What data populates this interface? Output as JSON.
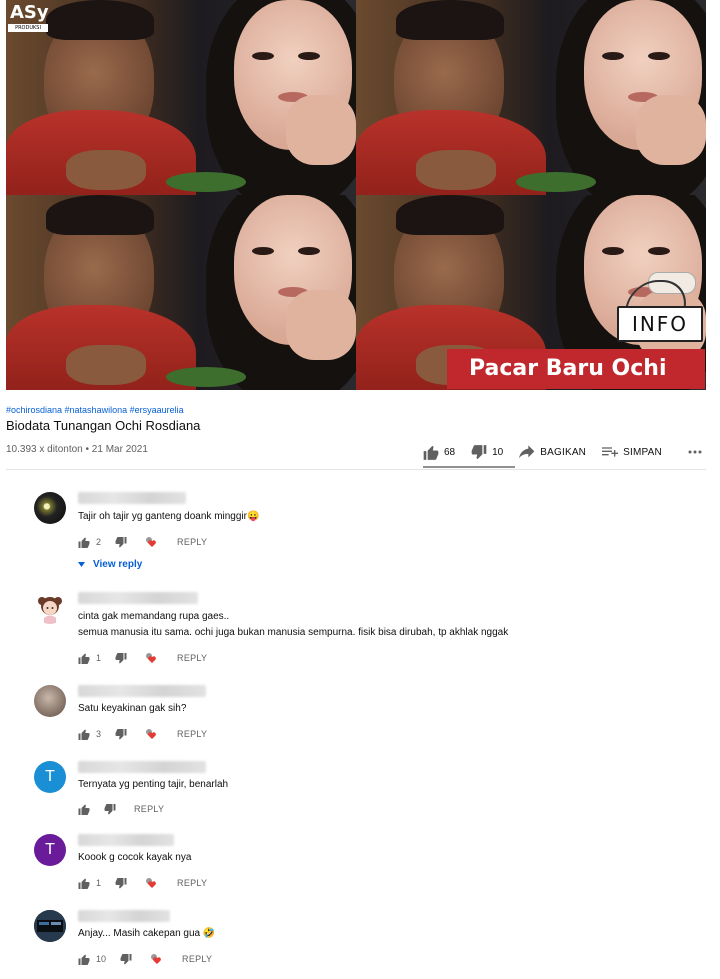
{
  "video": {
    "logo_text": "ASy",
    "logo_sub": "PRODUKSI",
    "info_sign": "INFO",
    "banner": "Pacar Baru Ochi"
  },
  "meta": {
    "hashtags": "#ochirosdiana #natashawilona #ersyaaurelia",
    "title": "Biodata Tunangan Ochi Rosdiana",
    "views": "10.393 x ditonton • 21 Mar 2021"
  },
  "actions": {
    "likes": "68",
    "dislikes": "10",
    "share_label": "BAGIKAN",
    "save_label": "SIMPAN"
  },
  "comments": [
    {
      "text": "Tajir oh tajir yg ganteng doank minggir😛",
      "likes": "2",
      "reply_label": "REPLY",
      "view_reply": "View reply",
      "avatar": "photo-dark"
    },
    {
      "text_lines": [
        "cinta gak memandang rupa gaes..",
        "semua manusia itu sama. ochi juga bukan manusia sempurna. fisik bisa dirubah, tp akhlak nggak"
      ],
      "likes": "1",
      "reply_label": "REPLY",
      "avatar": "cartoon-girl"
    },
    {
      "text": "Satu keyakinan gak sih?",
      "likes": "3",
      "reply_label": "REPLY",
      "avatar": "photo-blur"
    },
    {
      "text": "Ternyata yg penting tajir, benarlah",
      "likes": "",
      "reply_label": "REPLY",
      "avatar_letter": "T",
      "avatar_color": "#1a8fd6"
    },
    {
      "text": "Koook g cocok kayak nya",
      "likes": "1",
      "reply_label": "REPLY",
      "avatar_letter": "T",
      "avatar_color": "#6a1b9a"
    },
    {
      "text": "Anjay... Masih cakepan gua 🤣",
      "likes": "10",
      "reply_label": "REPLY",
      "avatar": "photo-screen"
    }
  ]
}
